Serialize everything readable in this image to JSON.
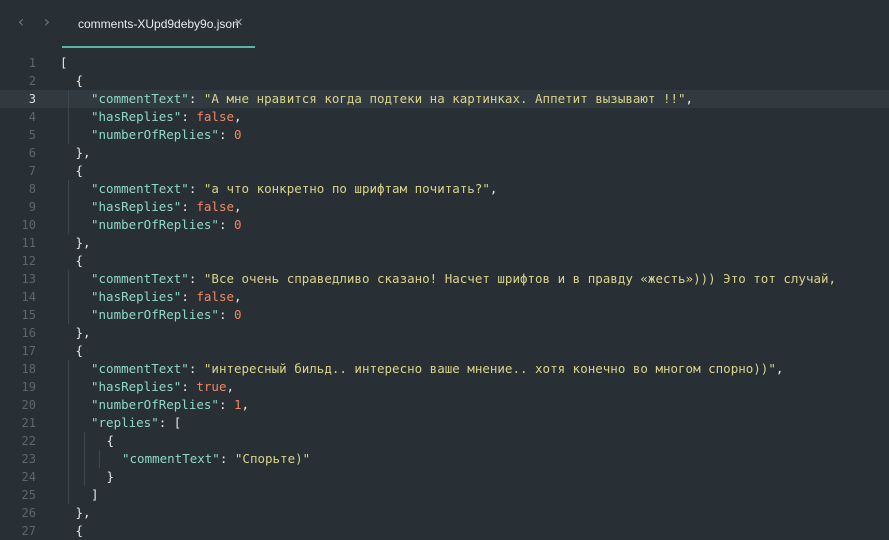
{
  "tab": {
    "title": "comments-XUpd9deby9o.json"
  },
  "editor": {
    "active_line": 3,
    "line_numbers": [
      "1",
      "2",
      "3",
      "4",
      "5",
      "6",
      "7",
      "8",
      "9",
      "10",
      "11",
      "12",
      "13",
      "14",
      "15",
      "16",
      "17",
      "18",
      "19",
      "20",
      "21",
      "22",
      "23",
      "24",
      "25",
      "26",
      "27"
    ],
    "lines": [
      {
        "indent": 0,
        "tokens": [
          {
            "t": "p",
            "v": "["
          }
        ]
      },
      {
        "indent": 1,
        "tokens": [
          {
            "t": "p",
            "v": "{"
          }
        ]
      },
      {
        "indent": 2,
        "tokens": [
          {
            "t": "k",
            "v": "\"commentText\""
          },
          {
            "t": "p",
            "v": ": "
          },
          {
            "t": "s",
            "v": "\"А мне нравится когда подтеки на картинках. Аппетит вызывают !!\""
          },
          {
            "t": "p",
            "v": ","
          }
        ]
      },
      {
        "indent": 2,
        "tokens": [
          {
            "t": "k",
            "v": "\"hasReplies\""
          },
          {
            "t": "p",
            "v": ": "
          },
          {
            "t": "b",
            "v": "false"
          },
          {
            "t": "p",
            "v": ","
          }
        ]
      },
      {
        "indent": 2,
        "tokens": [
          {
            "t": "k",
            "v": "\"numberOfReplies\""
          },
          {
            "t": "p",
            "v": ": "
          },
          {
            "t": "n",
            "v": "0"
          }
        ]
      },
      {
        "indent": 1,
        "tokens": [
          {
            "t": "p",
            "v": "},"
          }
        ]
      },
      {
        "indent": 1,
        "tokens": [
          {
            "t": "p",
            "v": "{"
          }
        ]
      },
      {
        "indent": 2,
        "tokens": [
          {
            "t": "k",
            "v": "\"commentText\""
          },
          {
            "t": "p",
            "v": ": "
          },
          {
            "t": "s",
            "v": "\"а что конкретно по шрифтам почитать?\""
          },
          {
            "t": "p",
            "v": ","
          }
        ]
      },
      {
        "indent": 2,
        "tokens": [
          {
            "t": "k",
            "v": "\"hasReplies\""
          },
          {
            "t": "p",
            "v": ": "
          },
          {
            "t": "b",
            "v": "false"
          },
          {
            "t": "p",
            "v": ","
          }
        ]
      },
      {
        "indent": 2,
        "tokens": [
          {
            "t": "k",
            "v": "\"numberOfReplies\""
          },
          {
            "t": "p",
            "v": ": "
          },
          {
            "t": "n",
            "v": "0"
          }
        ]
      },
      {
        "indent": 1,
        "tokens": [
          {
            "t": "p",
            "v": "},"
          }
        ]
      },
      {
        "indent": 1,
        "tokens": [
          {
            "t": "p",
            "v": "{"
          }
        ]
      },
      {
        "indent": 2,
        "tokens": [
          {
            "t": "k",
            "v": "\"commentText\""
          },
          {
            "t": "p",
            "v": ": "
          },
          {
            "t": "s",
            "v": "\"Все очень справедливо сказано! Насчет шрифтов и в правду «жесть»))) Это тот случай,"
          }
        ]
      },
      {
        "indent": 2,
        "tokens": [
          {
            "t": "k",
            "v": "\"hasReplies\""
          },
          {
            "t": "p",
            "v": ": "
          },
          {
            "t": "b",
            "v": "false"
          },
          {
            "t": "p",
            "v": ","
          }
        ]
      },
      {
        "indent": 2,
        "tokens": [
          {
            "t": "k",
            "v": "\"numberOfReplies\""
          },
          {
            "t": "p",
            "v": ": "
          },
          {
            "t": "n",
            "v": "0"
          }
        ]
      },
      {
        "indent": 1,
        "tokens": [
          {
            "t": "p",
            "v": "},"
          }
        ]
      },
      {
        "indent": 1,
        "tokens": [
          {
            "t": "p",
            "v": "{"
          }
        ]
      },
      {
        "indent": 2,
        "tokens": [
          {
            "t": "k",
            "v": "\"commentText\""
          },
          {
            "t": "p",
            "v": ": "
          },
          {
            "t": "s",
            "v": "\"интересный бильд.. интересно ваше мнение.. хотя конечно во многом спорно))\""
          },
          {
            "t": "p",
            "v": ","
          }
        ]
      },
      {
        "indent": 2,
        "tokens": [
          {
            "t": "k",
            "v": "\"hasReplies\""
          },
          {
            "t": "p",
            "v": ": "
          },
          {
            "t": "b",
            "v": "true"
          },
          {
            "t": "p",
            "v": ","
          }
        ]
      },
      {
        "indent": 2,
        "tokens": [
          {
            "t": "k",
            "v": "\"numberOfReplies\""
          },
          {
            "t": "p",
            "v": ": "
          },
          {
            "t": "n",
            "v": "1"
          },
          {
            "t": "p",
            "v": ","
          }
        ]
      },
      {
        "indent": 2,
        "tokens": [
          {
            "t": "k",
            "v": "\"replies\""
          },
          {
            "t": "p",
            "v": ": ["
          }
        ]
      },
      {
        "indent": 3,
        "tokens": [
          {
            "t": "p",
            "v": "{"
          }
        ]
      },
      {
        "indent": 4,
        "tokens": [
          {
            "t": "k",
            "v": "\"commentText\""
          },
          {
            "t": "p",
            "v": ": "
          },
          {
            "t": "s",
            "v": "\"Спорьте)\""
          }
        ]
      },
      {
        "indent": 3,
        "tokens": [
          {
            "t": "p",
            "v": "}"
          }
        ]
      },
      {
        "indent": 2,
        "tokens": [
          {
            "t": "p",
            "v": "]"
          }
        ]
      },
      {
        "indent": 1,
        "tokens": [
          {
            "t": "p",
            "v": "},"
          }
        ]
      },
      {
        "indent": 1,
        "tokens": [
          {
            "t": "p",
            "v": "{"
          }
        ]
      }
    ]
  }
}
